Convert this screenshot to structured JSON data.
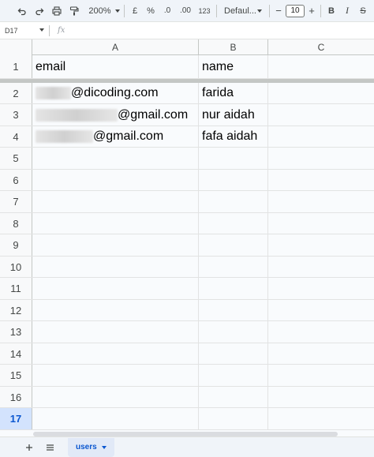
{
  "toolbar": {
    "zoom": "200%",
    "currency": "£",
    "percent": "%",
    "decrease_decimal": ".0",
    "increase_decimal": ".00",
    "number_format": "123",
    "font": "Defaul...",
    "font_size": "10",
    "minus": "−",
    "plus": "+",
    "bold": "B",
    "italic": "I",
    "strike": "S"
  },
  "formula_bar": {
    "cell_ref": "D17",
    "fx": "fx",
    "content": ""
  },
  "columns": [
    "A",
    "B",
    "C"
  ],
  "rows": [
    {
      "num": "1",
      "a": "email",
      "b": "name",
      "a_redacted": false
    },
    {
      "num": "2",
      "a": "@dicoding.com",
      "b": "farida",
      "a_redacted": true
    },
    {
      "num": "3",
      "a": "@gmail.com",
      "b": "nur aidah",
      "a_redacted": true
    },
    {
      "num": "4",
      "a": "@gmail.com",
      "b": "fafa aidah",
      "a_redacted": true
    },
    {
      "num": "5",
      "a": "",
      "b": ""
    },
    {
      "num": "6",
      "a": "",
      "b": ""
    },
    {
      "num": "7",
      "a": "",
      "b": ""
    },
    {
      "num": "8",
      "a": "",
      "b": ""
    },
    {
      "num": "9",
      "a": "",
      "b": ""
    },
    {
      "num": "10",
      "a": "",
      "b": ""
    },
    {
      "num": "11",
      "a": "",
      "b": ""
    },
    {
      "num": "12",
      "a": "",
      "b": ""
    },
    {
      "num": "13",
      "a": "",
      "b": ""
    },
    {
      "num": "14",
      "a": "",
      "b": ""
    },
    {
      "num": "15",
      "a": "",
      "b": ""
    },
    {
      "num": "16",
      "a": "",
      "b": ""
    },
    {
      "num": "17",
      "a": "",
      "b": ""
    }
  ],
  "active_row": "17",
  "sheets": [
    {
      "label": "users",
      "active": true
    }
  ],
  "colors": {
    "accent": "#0b57d0",
    "selection": "#d3e3fd"
  }
}
